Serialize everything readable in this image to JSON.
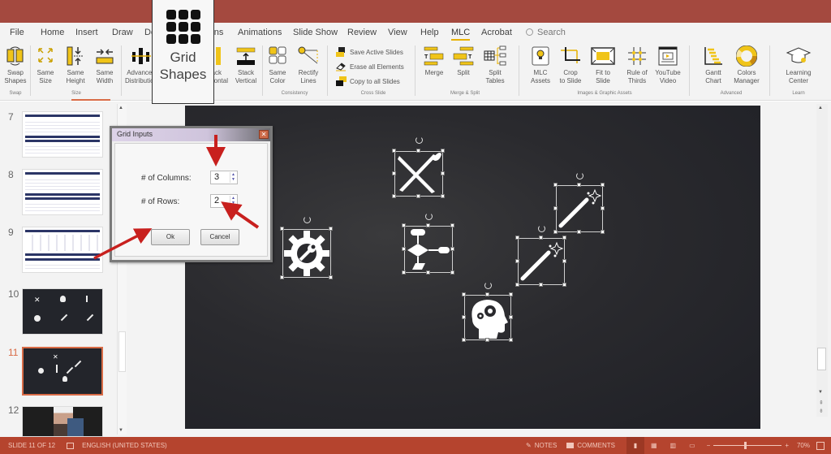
{
  "tabs": [
    {
      "label": "File"
    },
    {
      "label": "Home"
    },
    {
      "label": "Insert"
    },
    {
      "label": "Draw"
    },
    {
      "label": "Design"
    },
    {
      "label": "Transitions"
    },
    {
      "label": "Animations"
    },
    {
      "label": "Slide Show"
    },
    {
      "label": "Review"
    },
    {
      "label": "View"
    },
    {
      "label": "Help"
    },
    {
      "label": "MLC",
      "active": true
    },
    {
      "label": "Acrobat"
    }
  ],
  "search": {
    "placeholder": "Search"
  },
  "callout": {
    "label_line1": "Grid",
    "label_line2": "Shapes"
  },
  "ribbon": {
    "swap_shapes": [
      "Swap",
      "Shapes"
    ],
    "same_size": [
      "Same",
      "Size"
    ],
    "same_height": [
      "Same",
      "Height"
    ],
    "same_width": [
      "Same",
      "Width"
    ],
    "advanced_distribution": [
      "Advanced",
      "Distribution"
    ],
    "stack_horizontal": [
      "Stack",
      "Horizontal"
    ],
    "stack_vertical": [
      "Stack",
      "Vertical"
    ],
    "same_color": [
      "Same",
      "Color"
    ],
    "rectify_lines": [
      "Rectify",
      "Lines"
    ],
    "save_active_slides": "Save Active Slides",
    "erase_all_elements": "Erase all Elements",
    "copy_to_all_slides": "Copy to all Slides",
    "merge": "Merge",
    "split": "Split",
    "split_tables": [
      "Split",
      "Tables"
    ],
    "mlc_assets": [
      "MLC",
      "Assets"
    ],
    "crop_to_slide": [
      "Crop",
      "to Slide"
    ],
    "fit_to_slide": [
      "Fit to",
      "Slide"
    ],
    "rule_of_thirds": [
      "Rule of",
      "Thirds"
    ],
    "youtube_video": [
      "YouTube",
      "Video"
    ],
    "gantt_chart": [
      "Gantt",
      "Chart"
    ],
    "colors_manager": [
      "Colors",
      "Manager"
    ],
    "learning_center": [
      "Learning",
      "Center"
    ],
    "groups": {
      "swap": "Swap",
      "size": "Size",
      "consistency": "Consistency",
      "cross_slide": "Cross Slide",
      "merge_split": "Merge & Split",
      "images": "Images & Graphic Assets",
      "advanced": "Advanced",
      "learn": "Learn"
    }
  },
  "thumbnails": [
    {
      "num": "7"
    },
    {
      "num": "8"
    },
    {
      "num": "9"
    },
    {
      "num": "10"
    },
    {
      "num": "11",
      "selected": true
    },
    {
      "num": "12"
    }
  ],
  "dialog": {
    "title": "Grid Inputs",
    "columns_label": "# of Columns:",
    "columns_value": "3",
    "rows_label": "# of Rows:",
    "rows_value": "2",
    "ok_label": "Ok",
    "cancel_label": "Cancel"
  },
  "slide_shapes": [
    "tools-icon",
    "flowchart-icon",
    "gear-wrench-icon",
    "magic-wand-icon",
    "magic-wand-icon",
    "head-gears-icon"
  ],
  "status": {
    "slide_info": "SLIDE 11 OF 12",
    "language": "ENGLISH (UNITED STATES)",
    "notes": "NOTES",
    "comments": "COMMENTS",
    "zoom": "70%",
    "zoom_level": 0.45
  },
  "colors": {
    "titlebar": "#a4493f",
    "status": "#b5442e",
    "accent": "#e8b100",
    "selected_thumb": "#d86b46"
  }
}
